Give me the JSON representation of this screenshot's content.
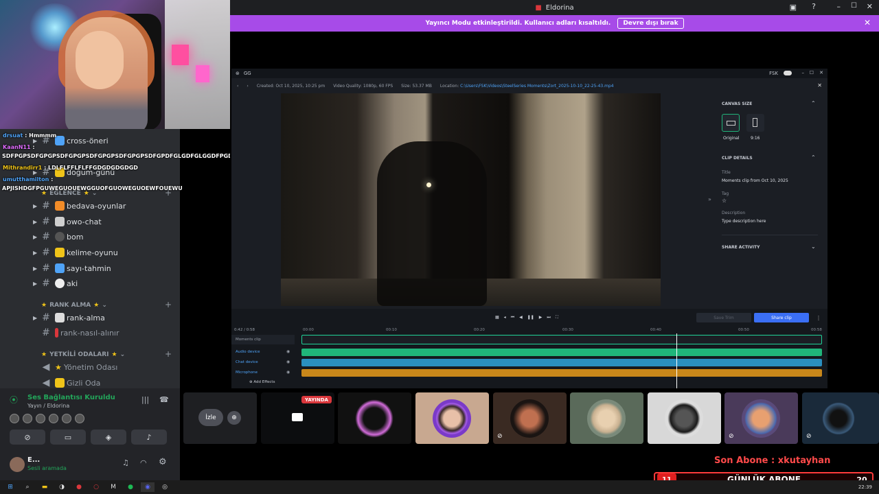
{
  "window": {
    "title": "Eldorina"
  },
  "banner": {
    "text": "Yayıncı Modu etkinleştirildi. Kullanıcı adları kısaltıldı.",
    "button": "Devre dışı bırak"
  },
  "chat": [
    {
      "user": "drsuat",
      "msg": ": Hmmmm",
      "color": "#4fa3f7"
    },
    {
      "user": "KaanN11",
      "msg": ":",
      "color": "#e06cff"
    },
    {
      "user": "",
      "msg": "SDFPGPSDFGPGPSDFGPGPSDFGPGPSDFGPGPSDFGPDFGLGDFGLGGDFPGDFDLS",
      "color": "#fff"
    },
    {
      "user": "Mithrandirr1",
      "msg": ": LDLFLFFLFLFFGDGDGDGDGD",
      "color": "#f0c419"
    },
    {
      "user": "umutthamilton",
      "msg": ":",
      "color": "#4fa3f7"
    },
    {
      "user": "",
      "msg": "APJISHDGFPGUWEGUOUEWGGUOFGUOWEGUOEWFOUEWU",
      "color": "#fff"
    }
  ],
  "sidebar": {
    "channels_top": [
      {
        "label": "cross-öneri",
        "emoji_color": "#4fa3f7"
      },
      {
        "label": "doğum-günü",
        "emoji_color": "#f0c419"
      }
    ],
    "cat_eglence": "EĞLENCE",
    "channels_eglence": [
      {
        "label": "bedava-oyunlar",
        "emoji_color": "#f28c28"
      },
      {
        "label": "owo-chat",
        "emoji_color": "#cfcfcf"
      },
      {
        "label": "bom",
        "emoji_color": "#555"
      },
      {
        "label": "kelime-oyunu",
        "emoji_color": "#f0c419"
      },
      {
        "label": "sayı-tahmin",
        "emoji_color": "#4fa3f7"
      },
      {
        "label": "aki",
        "emoji_color": "#eee"
      }
    ],
    "cat_rank": "RANK ALMA",
    "channels_rank": [
      {
        "label": "rank-alma",
        "emoji_color": "#ddd"
      },
      {
        "label": "rank-nasıl-alınır",
        "emoji_color": "#da373c"
      }
    ],
    "cat_yetkili": "YETKİLİ ODALARI",
    "voice_channels": [
      {
        "label": "Yönetim Odası"
      },
      {
        "label": "Gizli Oda"
      }
    ]
  },
  "voice": {
    "status": "Ses Bağlantısı Kuruldu",
    "sub": "Yayın / Eldorina"
  },
  "user": {
    "name": "E...",
    "status": "Sesli aramada"
  },
  "app": {
    "title": "GG",
    "fsk": "FSK",
    "meta": {
      "created_label": "Created:",
      "created": "Oct 10, 2025, 10:25 pm",
      "quality_label": "Video Quality:",
      "quality": "1080p, 60 FPS",
      "size_label": "Size:",
      "size": "53.37 MB",
      "location_label": "Location:",
      "location": "C:\\Users\\FSK\\Videos\\SteelSeries Moments\\Zort_2025-10-10_22-25-43.mp4"
    },
    "canvas": {
      "header": "CANVAS SIZE",
      "opt1": "Original",
      "opt2": "9:16"
    },
    "details": {
      "header": "CLIP DETAILS",
      "title_label": "Title",
      "title_value": "Moments clip from Oct 10, 2025",
      "tag_label": "Tag",
      "desc_label": "Description",
      "desc_value": "Type description here"
    },
    "share_activity": "SHARE ACTIVITY",
    "timeline": {
      "time": "0:42 / 0:58",
      "ticks": [
        "00:00",
        "00:10",
        "00:20",
        "00:30",
        "00:40",
        "00:50",
        "00:58"
      ],
      "tracks": [
        {
          "label": "Moments clip",
          "color": "#1b1e24"
        },
        {
          "label": "Audio device",
          "color": "#20b57a"
        },
        {
          "label": "Chat device",
          "color": "#2a8fbf"
        },
        {
          "label": "Microphone",
          "color": "#c8871a"
        }
      ],
      "add_effects": "Add Effects",
      "save_trim": "Save Trim",
      "share_clip": "Share clip",
      "playhead_fraction": 0.72
    }
  },
  "tiles": {
    "watch": "İzle",
    "live": "YAYINDA"
  },
  "alerts": {
    "son_abone": "Son Abone : xkutayhan",
    "gunluk_num": "11",
    "gunluk_label": "GÜNLÜK ABONE",
    "gunluk_goal": "20"
  },
  "taskbar": {
    "time": "22:39"
  }
}
